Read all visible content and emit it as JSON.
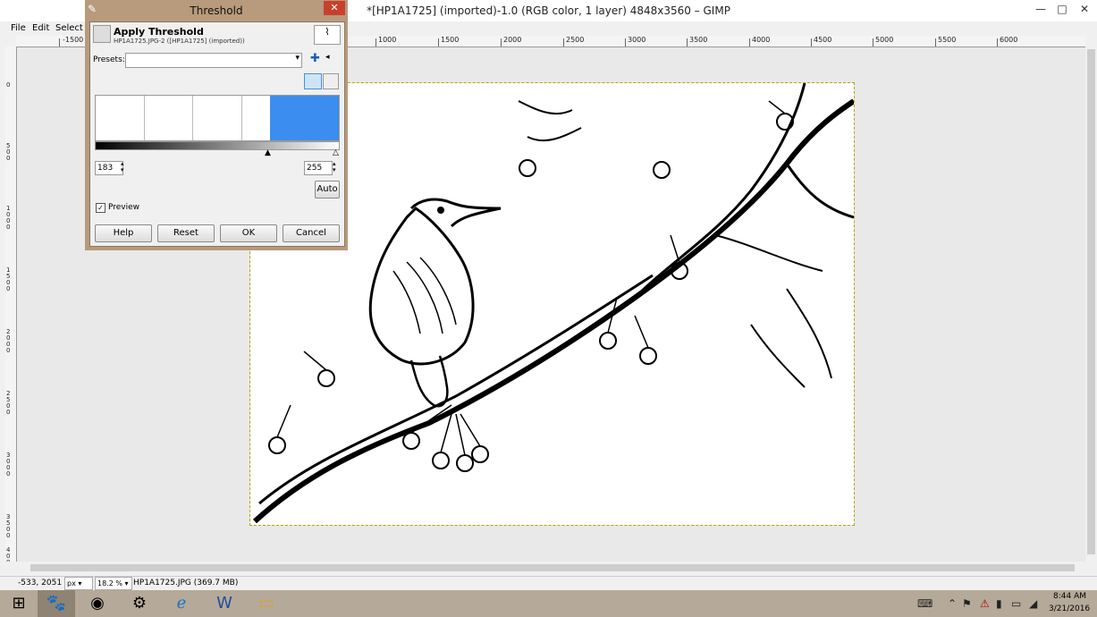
{
  "window": {
    "title": "*[HP1A1725] (imported)-1.0 (RGB color, 1 layer) 4848x3560 – GIMP",
    "minimize": "—",
    "maximize": "□",
    "close": "✕"
  },
  "menubar": {
    "items": [
      "File",
      "Edit",
      "Select"
    ]
  },
  "ruler": {
    "h_labels": [
      "-1500",
      "1000",
      "1500",
      "2000",
      "2500",
      "3000",
      "3500",
      "4000",
      "4500",
      "5000",
      "5500",
      "6000"
    ],
    "v_labels": [
      "0",
      "500",
      "1000",
      "1500",
      "2000",
      "2500",
      "3000",
      "3500",
      "4000"
    ]
  },
  "dialog": {
    "title": "Threshold",
    "close": "✕",
    "heading": "Apply Threshold",
    "subheading": "HP1A1725.JPG-2 ([HP1A1725] (imported))",
    "presets_label": "Presets:",
    "presets_value": "",
    "low_value": "183",
    "high_value": "255",
    "auto_label": "Auto",
    "preview_label": "Preview",
    "preview_checked": true,
    "buttons": {
      "help": "Help",
      "reset": "Reset",
      "ok": "OK",
      "cancel": "Cancel"
    }
  },
  "statusbar": {
    "coords": "-533, 2051",
    "unit": "px",
    "zoom": "18.2 %",
    "file_info": "HP1A1725.JPG (369.7 MB)"
  },
  "taskbar": {
    "items": [
      "windows-start",
      "gimp",
      "chrome",
      "greenshot",
      "internet-explorer",
      "word",
      "file-explorer"
    ],
    "time": "8:44 AM",
    "date": "3/21/2016",
    "tray_icons": [
      "keyboard-icon",
      "chevron-up-icon",
      "flag-icon",
      "battery-icon",
      "monitor-icon",
      "volume-icon",
      "wifi-icon"
    ]
  }
}
